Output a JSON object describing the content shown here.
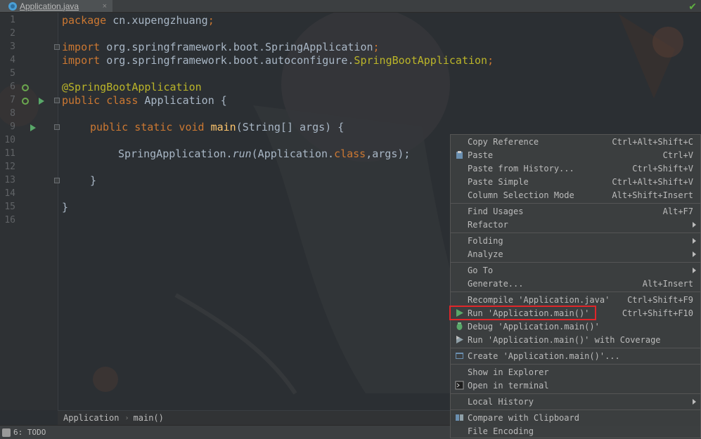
{
  "editor": {
    "tab_title": "Application.java",
    "tab_close": "×",
    "inspection_mark": "✔",
    "line_numbers": [
      "1",
      "2",
      "3",
      "4",
      "5",
      "6",
      "7",
      "8",
      "9",
      "10",
      "11",
      "12",
      "13",
      "14",
      "15",
      "16"
    ],
    "code": {
      "l1_kw": "package",
      "l1_rest": " cn.xupengzhuang",
      "l1_semi": ";",
      "l3_kw": "import",
      "l3_rest": " org.springframework.boot.SpringApplication",
      "l3_semi": ";",
      "l4_kw": "import",
      "l4_rest": " org.springframework.boot.autoconfigure.",
      "l4_cls": "SpringBootApplication",
      "l4_semi": ";",
      "l6_ann": "@SpringBootApplication",
      "l7_kw": "public class",
      "l7_rest": " Application {",
      "l9_kw": "public static void",
      "l9_fn": " main",
      "l9_rest": "(String[] args) {",
      "l11_a": "SpringApplication.",
      "l11_run": "run",
      "l11_b": "(Application.",
      "l11_kw": "class",
      "l11_c": ",args);",
      "l13": "}",
      "l15": "}"
    }
  },
  "breadcrumb": {
    "items": [
      "Application",
      "main()"
    ],
    "separator": "›"
  },
  "statusbar": {
    "todo_label": "6: TODO"
  },
  "context_menu": {
    "items": [
      {
        "label": "Copy Reference",
        "shortcut": "Ctrl+Alt+Shift+C"
      },
      {
        "label": "Paste",
        "shortcut": "Ctrl+V"
      },
      {
        "label": "Paste from History...",
        "shortcut": "Ctrl+Shift+V"
      },
      {
        "label": "Paste Simple",
        "shortcut": "Ctrl+Alt+Shift+V"
      },
      {
        "label": "Column Selection Mode",
        "shortcut": "Alt+Shift+Insert"
      },
      {
        "label": "Find Usages",
        "shortcut": "Alt+F7"
      },
      {
        "label": "Refactor",
        "shortcut": ""
      },
      {
        "label": "Folding",
        "shortcut": ""
      },
      {
        "label": "Analyze",
        "shortcut": ""
      },
      {
        "label": "Go To",
        "shortcut": ""
      },
      {
        "label": "Generate...",
        "shortcut": "Alt+Insert"
      },
      {
        "label": "Recompile 'Application.java'",
        "shortcut": "Ctrl+Shift+F9"
      },
      {
        "label": "Run 'Application.main()'",
        "shortcut": "Ctrl+Shift+F10"
      },
      {
        "label": "Debug 'Application.main()'",
        "shortcut": ""
      },
      {
        "label": "Run 'Application.main()' with Coverage",
        "shortcut": ""
      },
      {
        "label": "Create 'Application.main()'...",
        "shortcut": ""
      },
      {
        "label": "Show in Explorer",
        "shortcut": ""
      },
      {
        "label": "Open in terminal",
        "shortcut": ""
      },
      {
        "label": "Local History",
        "shortcut": ""
      },
      {
        "label": "Compare with Clipboard",
        "shortcut": ""
      },
      {
        "label": "File Encoding",
        "shortcut": ""
      }
    ]
  },
  "colors": {
    "highlight_box": "#e0262a",
    "run_green": "#59a869",
    "keyword": "#cc7832",
    "annotation": "#bbb529"
  }
}
